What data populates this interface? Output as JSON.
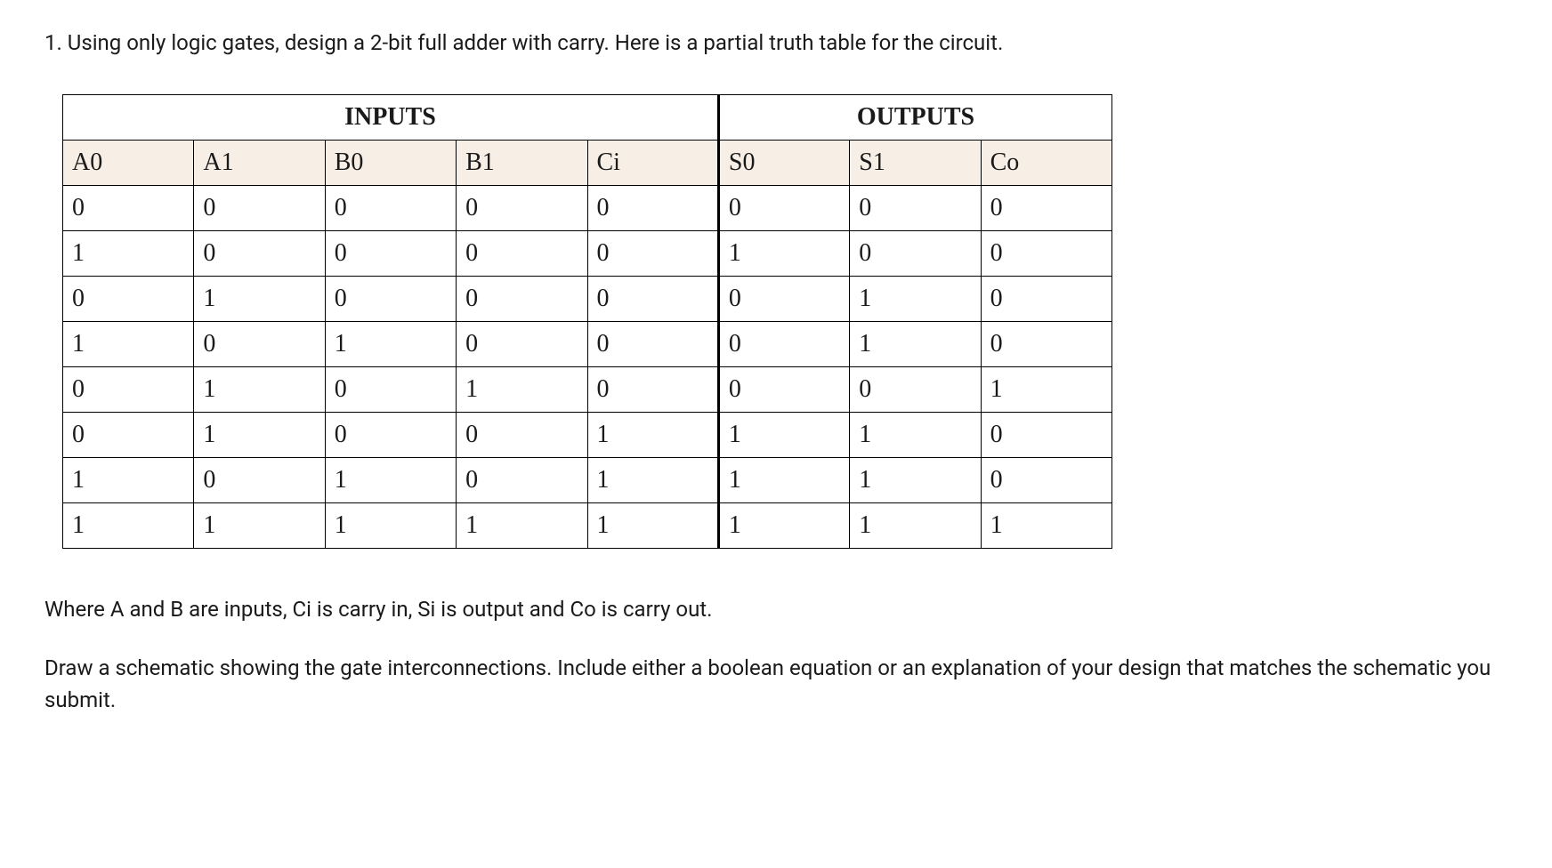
{
  "question": "1. Using only logic gates, design a 2-bit full adder with carry. Here is a partial truth table for the circuit.",
  "table": {
    "section_headers": {
      "inputs": "INPUTS",
      "outputs": "OUTPUTS"
    },
    "columns": [
      "A0",
      "A1",
      "B0",
      "B1",
      "Ci",
      "S0",
      "S1",
      "Co"
    ],
    "rows": [
      [
        "0",
        "0",
        "0",
        "0",
        "0",
        "0",
        "0",
        "0"
      ],
      [
        "1",
        "0",
        "0",
        "0",
        "0",
        "1",
        "0",
        "0"
      ],
      [
        "0",
        "1",
        "0",
        "0",
        "0",
        "0",
        "1",
        "0"
      ],
      [
        "1",
        "0",
        "1",
        "0",
        "0",
        "0",
        "1",
        "0"
      ],
      [
        "0",
        "1",
        "0",
        "1",
        "0",
        "0",
        "0",
        "1"
      ],
      [
        "0",
        "1",
        "0",
        "0",
        "1",
        "1",
        "1",
        "0"
      ],
      [
        "1",
        "0",
        "1",
        "0",
        "1",
        "1",
        "1",
        "0"
      ],
      [
        "1",
        "1",
        "1",
        "1",
        "1",
        "1",
        "1",
        "1"
      ]
    ]
  },
  "explanation": "Where A and B are inputs, Ci is carry in, Si is output and Co is carry out.",
  "task": "Draw a schematic showing the gate interconnections. Include either a boolean equation or an explanation of your design that matches the schematic you submit."
}
